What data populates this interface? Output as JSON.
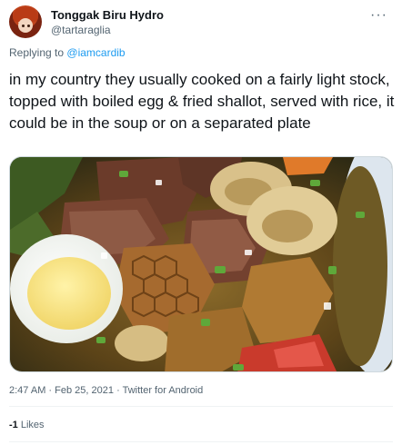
{
  "author": {
    "display_name": "Tonggak Biru Hydro",
    "handle": "@tartaraglia"
  },
  "reply": {
    "prefix": "Replying to",
    "mention": "@iamcardib"
  },
  "tweet": {
    "text": "in my country they usually cooked on a fairly light stock, topped with boiled egg & fried shallot, served with rice, it could be in the soup or on a separated plate"
  },
  "media": {
    "description_icon": "photo-icon"
  },
  "meta": {
    "time": "2:47 AM",
    "separator": "·",
    "date": "Feb 25, 2021",
    "source": "Twitter for Android"
  },
  "stats": {
    "likes_count": "-1",
    "likes_label": "Likes"
  },
  "colors": {
    "link": "#1d9bf0",
    "secondary_text": "#536471"
  }
}
